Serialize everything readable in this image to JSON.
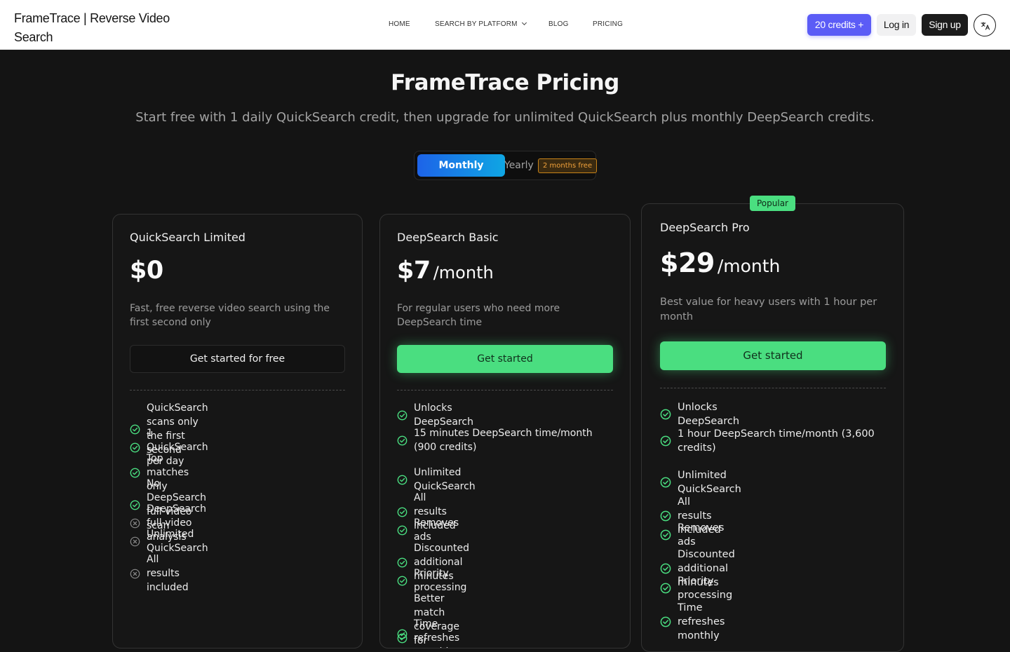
{
  "header": {
    "brand": "FrameTrace | Reverse Video Search",
    "nav": [
      {
        "label": "HOME"
      },
      {
        "label": "SEARCH BY PLATFORM"
      },
      {
        "label": "BLOG"
      },
      {
        "label": "PRICING"
      }
    ],
    "credits_label": "20 credits +",
    "login_label": "Log in",
    "signup_label": "Sign up",
    "language_icon": "translate-icon"
  },
  "hero": {
    "title": "FrameTrace Pricing",
    "subtitle": "Start free with 1 daily QuickSearch credit, then upgrade for unlimited QuickSearch plus monthly DeepSearch credits."
  },
  "billing_toggle": {
    "monthly_label": "Monthly",
    "yearly_label": "Yearly",
    "yearly_badge": "2 months free",
    "selected": "Monthly"
  },
  "plans": [
    {
      "name": "QuickSearch Limited",
      "price": "$0",
      "period": "",
      "description": "Fast, free reverse video search using the first second only",
      "cta": "Get started for free",
      "features": [
        {
          "text": "QuickSearch scans only the first second",
          "included": true
        },
        {
          "text": "1 QuickSearch per day",
          "included": true
        },
        {
          "text": "Top matches only",
          "included": true
        },
        {
          "text": "No DeepSearch full-video scan",
          "included": true
        },
        {
          "text": "DeepSearch full-video analysis",
          "included": false
        },
        {
          "text": "Unlimited QuickSearch",
          "included": false
        },
        {
          "text": "All results included",
          "included": false
        }
      ]
    },
    {
      "name": "DeepSearch Basic",
      "price": "$7",
      "period": "/month",
      "description": "For regular users who need more DeepSearch time",
      "cta": "Get started",
      "features": [
        {
          "text": "Unlocks DeepSearch",
          "included": true
        },
        {
          "text": "15 minutes DeepSearch time/month (900 credits)",
          "included": true
        },
        {
          "text": "Unlimited QuickSearch",
          "included": true
        },
        {
          "text": "All results included",
          "included": true
        },
        {
          "text": "Removes ads",
          "included": true
        },
        {
          "text": "Discounted additional minutes",
          "included": true
        },
        {
          "text": "Priority processing",
          "included": true
        },
        {
          "text": "Better match coverage for edited clips",
          "included": true
        },
        {
          "text": "Time refreshes monthly",
          "included": true
        }
      ]
    },
    {
      "name": "DeepSearch Pro",
      "badge": "Popular",
      "price": "$29",
      "period": "/month",
      "description": "Best value for heavy users with 1 hour per month",
      "cta": "Get started",
      "features": [
        {
          "text": "Unlocks DeepSearch",
          "included": true
        },
        {
          "text": "1 hour DeepSearch time/month (3,600 credits)",
          "included": true
        },
        {
          "text": "Unlimited QuickSearch",
          "included": true
        },
        {
          "text": "All results included",
          "included": true
        },
        {
          "text": "Removes ads",
          "included": true
        },
        {
          "text": "Discounted additional minutes",
          "included": true
        },
        {
          "text": "Priority processing",
          "included": true
        },
        {
          "text": "Time refreshes monthly",
          "included": true
        }
      ]
    }
  ],
  "colors": {
    "accent_green": "#4ade80",
    "credits_purple": "#5b5cf6",
    "toggle_blue": "#1d63e8",
    "badge_orange": "#f2a23b",
    "background": "#141414"
  }
}
